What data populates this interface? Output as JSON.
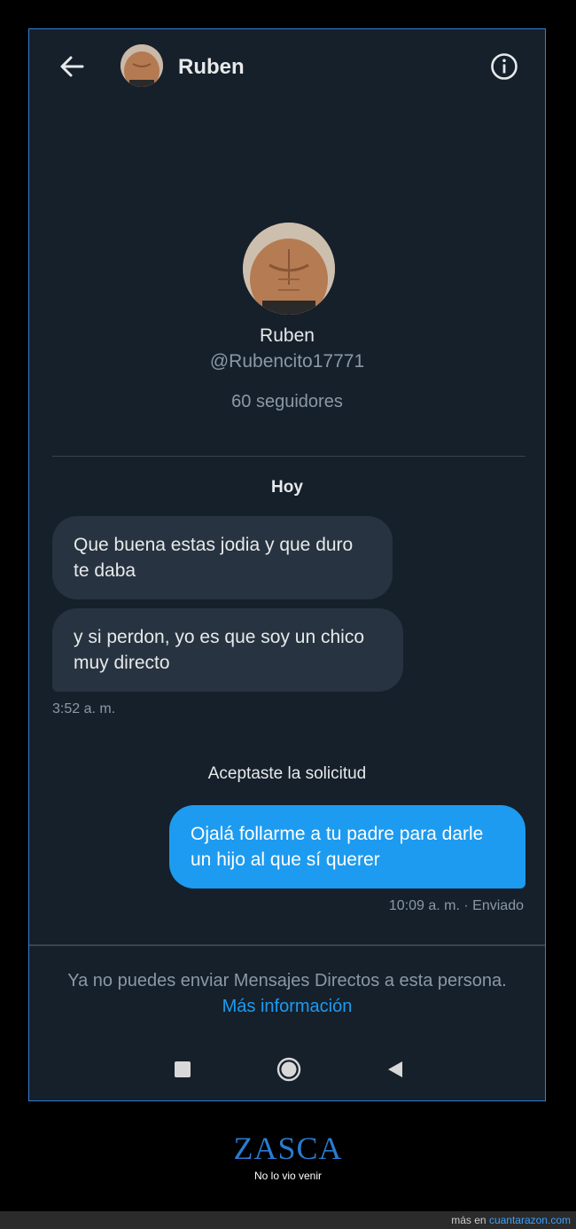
{
  "header": {
    "name": "Ruben",
    "back_icon": "back-arrow-icon",
    "info_icon": "info-icon"
  },
  "profile": {
    "name": "Ruben",
    "handle": "@Rubencito17771",
    "followers": "60 seguidores"
  },
  "conversation": {
    "day_label": "Hoy",
    "incoming": [
      {
        "text": "Que buena estas jodia y que duro te daba"
      },
      {
        "text": "y si perdon, yo es que soy un chico muy directo"
      }
    ],
    "incoming_time": "3:52 a. m.",
    "system_note": "Aceptaste la solicitud",
    "outgoing": [
      {
        "text": "Ojalá follarme a tu padre para darle un hijo al que sí querer"
      }
    ],
    "outgoing_time": "10:09 a. m. · Enviado"
  },
  "footer_notice": {
    "text": "Ya no puedes enviar Mensajes Directos a esta persona.",
    "link": "Más información"
  },
  "android_nav": {
    "recent_icon": "square-recents-icon",
    "home_icon": "circle-home-icon",
    "back_icon": "triangle-back-icon"
  },
  "meme": {
    "title": "ZASCA",
    "subtitle": "No lo vio venir",
    "credit_prefix": "más en",
    "credit_site": "cuantarazon.com"
  },
  "colors": {
    "background": "#15202b",
    "bubble_in": "#273340",
    "bubble_out": "#1d9bf0",
    "link": "#1d9bf0"
  }
}
